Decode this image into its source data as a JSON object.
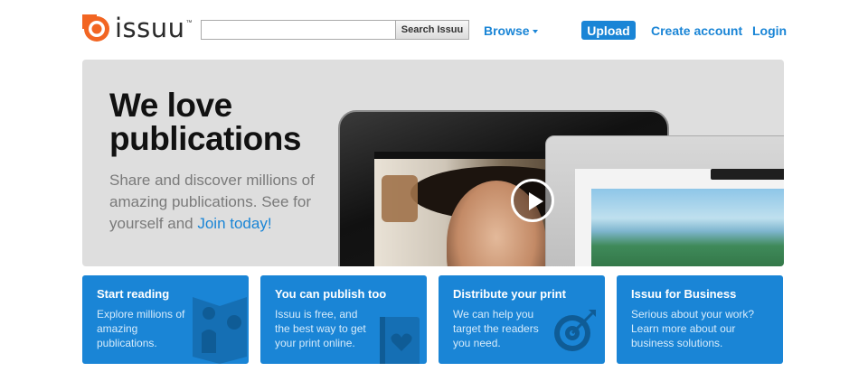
{
  "header": {
    "logo_text": "issuu",
    "logo_tm": "™",
    "search": {
      "placeholder": "",
      "value": "",
      "button_label": "Search Issuu"
    },
    "browse_label": "Browse",
    "upload_label": "Upload",
    "create_account_label": "Create account",
    "login_label": "Login"
  },
  "hero": {
    "title_line1": "We love",
    "title_line2": "publications",
    "subtitle": "Share and discover millions of amazing publications. See for yourself and ",
    "join_label": "Join today!"
  },
  "cards": [
    {
      "title": "Start reading",
      "text": "Explore millions of amazing publications."
    },
    {
      "title": "You can publish too",
      "text": "Issuu is free, and the best way to get your print online."
    },
    {
      "title": "Distribute your print",
      "text": "We can help you target the readers you need."
    },
    {
      "title": "Issuu for Business",
      "text": "Serious about your work? Learn more about our business solutions."
    }
  ],
  "colors": {
    "accent": "#1a85d6",
    "logo_orange": "#f26522",
    "hero_bg": "#dedede"
  },
  "icons": [
    "issuu-logo-icon",
    "caret-down-icon",
    "play-icon",
    "reading-icon",
    "book-heart-icon",
    "target-icon"
  ]
}
